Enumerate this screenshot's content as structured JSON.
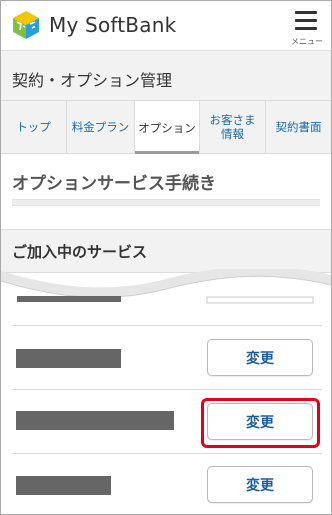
{
  "header": {
    "app_title": "My SoftBank",
    "menu_label": "メニュー",
    "logo_icon": "softbank-logo-icon",
    "menu_icon": "hamburger-menu-icon"
  },
  "page": {
    "title": "契約・オプション管理"
  },
  "tabs": [
    {
      "label": "トップ",
      "active": false
    },
    {
      "label": "料金プラン",
      "active": false
    },
    {
      "label": "オプション",
      "active": true
    },
    {
      "label": "お客さま\n情報",
      "active": false
    },
    {
      "label": "契約書面",
      "active": false
    }
  ],
  "section": {
    "title": "オプションサービス手続き"
  },
  "services": {
    "title": "ご加入中のサービス",
    "rows": [
      {
        "name": "",
        "action": "変更"
      },
      {
        "name": "",
        "action": "変更",
        "highlighted": true
      },
      {
        "name": "",
        "action": "変更"
      }
    ]
  },
  "colors": {
    "highlight": "#e3001b",
    "link": "#1a6aa8",
    "logo_yellow": "#f7c400",
    "logo_green": "#7dc142",
    "logo_blue": "#2aa0d8"
  }
}
